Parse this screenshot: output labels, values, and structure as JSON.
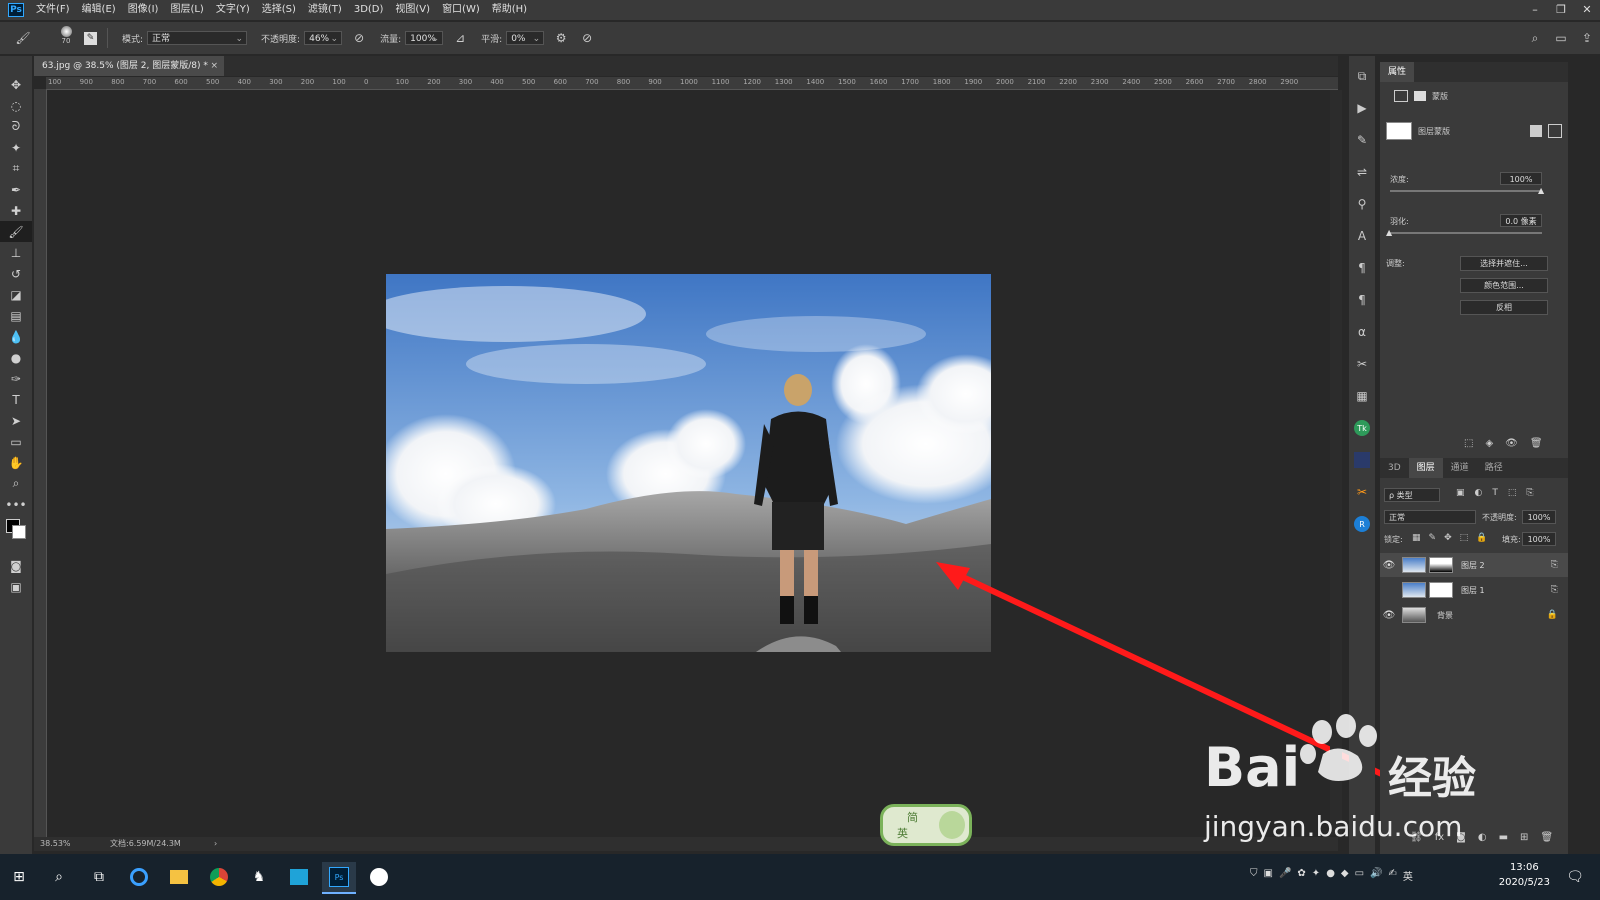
{
  "app": {
    "logo": "Ps"
  },
  "menu": [
    "文件(F)",
    "编辑(E)",
    "图像(I)",
    "图层(L)",
    "文字(Y)",
    "选择(S)",
    "滤镜(T)",
    "3D(D)",
    "视图(V)",
    "窗口(W)",
    "帮助(H)"
  ],
  "window_controls": [
    "–",
    "❐",
    "✕"
  ],
  "options": {
    "brush_size": "70",
    "mode_label": "模式:",
    "mode_value": "正常",
    "opacity_label": "不透明度:",
    "opacity_value": "46%",
    "flow_label": "流量:",
    "flow_value": "100%",
    "smoothing_label": "平滑:",
    "smoothing_value": "0%"
  },
  "document": {
    "tab_title": "63.jpg @ 38.5% (图层 2, 图层蒙版/8) *",
    "tab_close": "×",
    "zoom": "38.53%",
    "doc_info": "文档:6.59M/24.3M",
    "status_arrow": "›"
  },
  "ruler_top": [
    "100",
    "900",
    "800",
    "700",
    "600",
    "500",
    "400",
    "300",
    "200",
    "100",
    "0",
    "100",
    "200",
    "300",
    "400",
    "500",
    "600",
    "700",
    "800",
    "900",
    "1000",
    "1100",
    "1200",
    "1300",
    "1400",
    "1500",
    "1600",
    "1700",
    "1800",
    "1900",
    "2000",
    "2100",
    "2200",
    "2300",
    "2400",
    "2500",
    "2600",
    "2700",
    "2800",
    "2900"
  ],
  "properties": {
    "panel_title": "属性",
    "mask_type": "蒙版",
    "layer_mask_label": "图层蒙版",
    "density_label": "浓度:",
    "density_value": "100%",
    "density_level": 1.0,
    "feather_label": "羽化:",
    "feather_value": "0.0 像素",
    "feather_level": 0.0,
    "adjust_label": "调整:",
    "btn_select_mask": "选择并遮住...",
    "btn_color_range": "颜色范围...",
    "btn_invert": "反相"
  },
  "layers_panel": {
    "tabs": [
      "3D",
      "图层",
      "通道",
      "路径"
    ],
    "active_tab": "图层",
    "filter_label": "ρ 类型",
    "blend_mode": "正常",
    "opacity_label": "不透明度:",
    "opacity_value": "100%",
    "lock_label": "锁定:",
    "fill_label": "填充:",
    "fill_value": "100%",
    "layers": [
      {
        "name": "图层 2",
        "visible": true,
        "selected": true
      },
      {
        "name": "图层 1",
        "visible": false,
        "selected": false
      },
      {
        "name": "背景",
        "visible": true,
        "selected": false
      }
    ]
  },
  "taskbar": {
    "time": "13:06",
    "date": "2020/5/23",
    "ime": "英"
  },
  "watermark": {
    "brand": "Bai",
    "brand2": "经验",
    "url": "jingyan.baidu.com"
  },
  "sticker": {
    "char1": "简",
    "char2": "英"
  },
  "colors": {
    "accent": "#31a8ff",
    "arrow": "#ff1a1a",
    "panel": "#3a3a3a",
    "canvas": "#282828"
  }
}
